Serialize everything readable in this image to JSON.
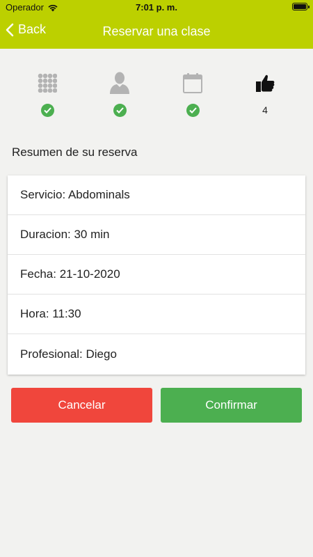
{
  "status_bar": {
    "carrier": "Operador",
    "time": "7:01 p. m."
  },
  "nav": {
    "back_label": "Back",
    "title": "Reservar una clase"
  },
  "steps": [
    {
      "icon": "grid-icon",
      "status": "done"
    },
    {
      "icon": "person-icon",
      "status": "done"
    },
    {
      "icon": "calendar-icon",
      "status": "done"
    },
    {
      "icon": "thumbs-up-icon",
      "status": "current",
      "number": "4"
    }
  ],
  "summary": {
    "title": "Resumen de su reserva",
    "rows": [
      "Servicio: Abdominals",
      "Duracion: 30 min",
      "Fecha: 21-10-2020",
      "Hora: 11:30",
      "Profesional: Diego"
    ]
  },
  "actions": {
    "cancel_label": "Cancelar",
    "confirm_label": "Confirmar"
  },
  "colors": {
    "header": "#bcd000",
    "cancel": "#f0463c",
    "confirm": "#4caf50",
    "check": "#4caf50"
  }
}
